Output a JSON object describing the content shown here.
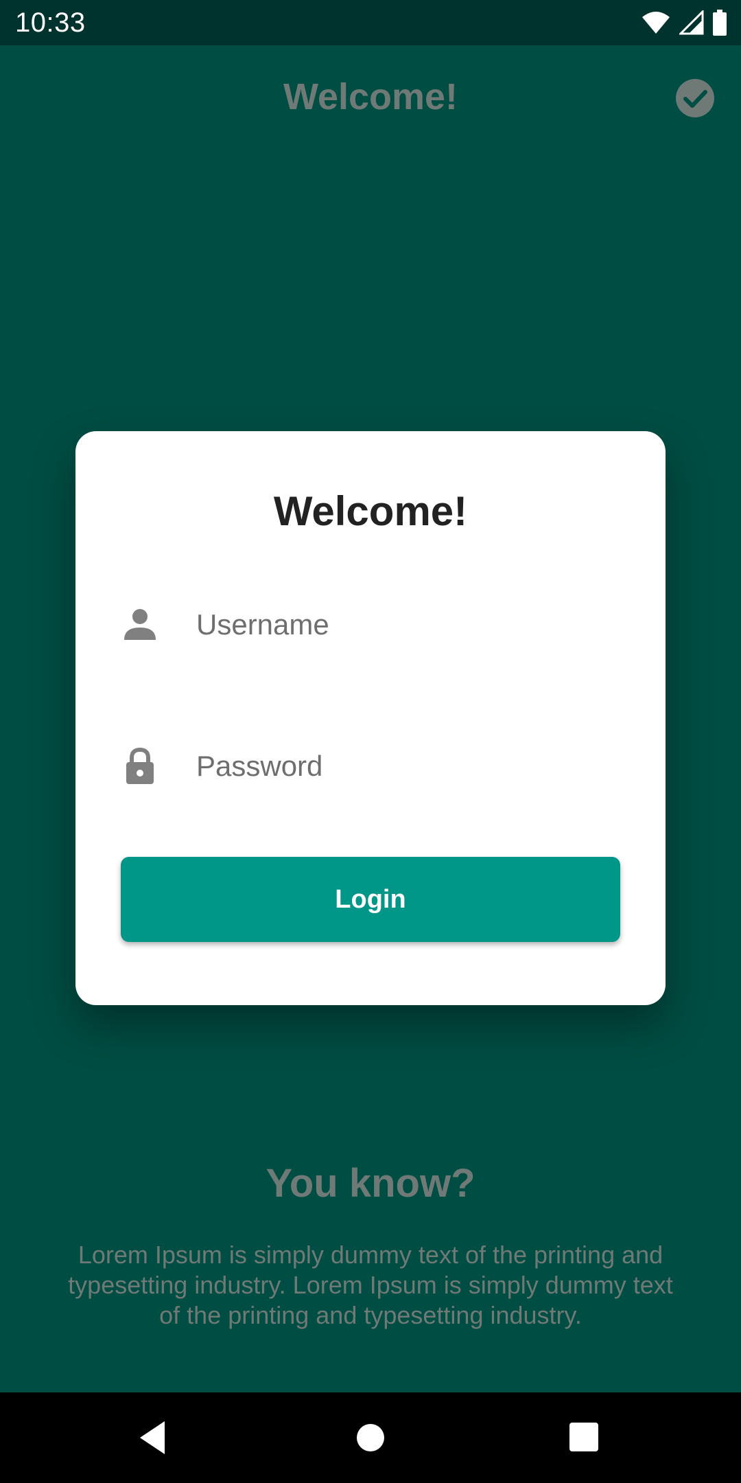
{
  "status_bar": {
    "time": "10:33",
    "icons": [
      "wifi-icon",
      "signal-icon",
      "battery-icon"
    ]
  },
  "app": {
    "title": "Welcome!",
    "header_action_icon": "check-circle-icon",
    "tip_title": "You know?",
    "tip_body": "Lorem Ipsum is simply dummy text of the printing and typesetting industry. Lorem Ipsum is simply dummy text of the printing and typesetting industry."
  },
  "dialog": {
    "title": "Welcome!",
    "username": {
      "value": "",
      "placeholder": "Username",
      "icon": "person-icon"
    },
    "password": {
      "value": "",
      "placeholder": "Password",
      "icon": "lock-icon"
    },
    "login_label": "Login"
  },
  "nav_bar": {
    "buttons": [
      "back-icon",
      "home-icon",
      "recents-icon"
    ]
  },
  "colors": {
    "background": "#004d43",
    "status_bar": "#00332d",
    "accent": "#009688",
    "dimmed_text": "#6f7a76",
    "card": "#ffffff"
  }
}
